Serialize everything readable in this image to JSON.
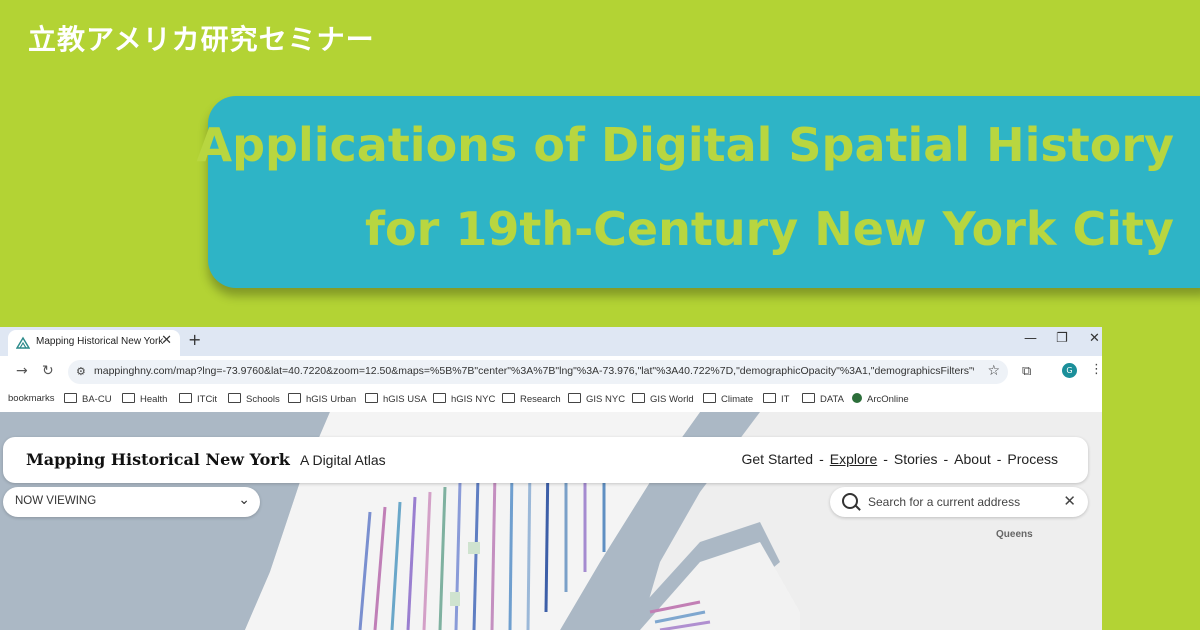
{
  "seminar_title": "立教アメリカ研究セミナー",
  "talk_title": {
    "line1": "Applications of Digital Spatial History",
    "line2": "for 19th-Century New York City"
  },
  "colors": {
    "background": "#b3d334",
    "title_box": "#2eb4c6",
    "title_text": "#b8d640",
    "water": "#abb8c5"
  },
  "browser": {
    "tab_title": "Mapping Historical New York",
    "tab_close": "✕",
    "new_tab": "+",
    "url": "mappinghny.com/map?lng=-73.9760&lat=40.7220&zoom=12.50&maps=%5B%7B\"center\"%3A%7B\"lng\"%3A-73.976,\"lat\"%3A40.722%7D,\"demographicOpacity\"%3A1,\"demographicsFilters\"%3...",
    "profile_initial": "G",
    "bookmarks": [
      "bookmarks",
      "BA-CU",
      "Health",
      "ITCit",
      "Schools",
      "hGIS Urban",
      "hGIS USA",
      "hGIS NYC",
      "Research",
      "GIS NYC",
      "GIS World",
      "Climate",
      "IT",
      "DATA",
      "ArcOnline"
    ]
  },
  "atlas": {
    "title": "Mapping Historical New York",
    "subtitle": "A Digital Atlas",
    "nav": [
      "Get Started",
      "Explore",
      "Stories",
      "About",
      "Process"
    ],
    "now_viewing": "NOW VIEWING",
    "search_placeholder": "Search for a current address",
    "map_label": "Queens"
  }
}
